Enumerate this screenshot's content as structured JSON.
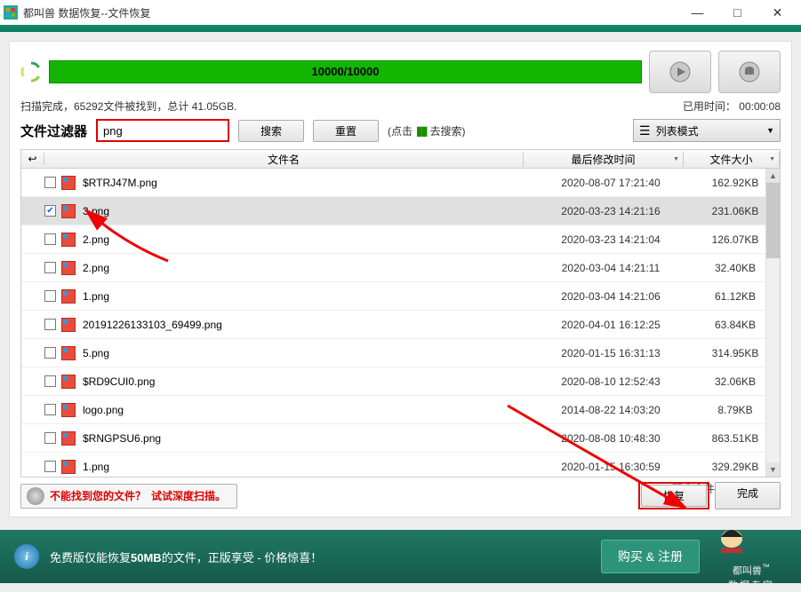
{
  "window": {
    "title": "都叫兽 数据恢复--文件恢复",
    "minimize": "—",
    "maximize": "□",
    "close": "✕"
  },
  "progress": {
    "text": "10000/10000"
  },
  "status": {
    "left": "扫描完成，65292文件被找到，总计 41.05GB.",
    "right_label": "已用时间：",
    "right_value": "00:00:08"
  },
  "filter": {
    "label": "文件过滤器",
    "value": "png",
    "search": "搜索",
    "reset": "重置",
    "hint_prefix": "(点击",
    "hint_suffix": "去搜索)",
    "view_mode": "列表模式"
  },
  "headers": {
    "back_icon": "↩",
    "name": "文件名",
    "date": "最后修改时间",
    "size": "文件大小"
  },
  "rows": [
    {
      "checked": false,
      "name": "$RTRJ47M.png",
      "date": "2020-08-07 17:21:40",
      "size": "162.92KB"
    },
    {
      "checked": true,
      "name": "3.png",
      "date": "2020-03-23 14:21:16",
      "size": "231.06KB",
      "selected": true
    },
    {
      "checked": false,
      "name": "2.png",
      "date": "2020-03-23 14:21:04",
      "size": "126.07KB"
    },
    {
      "checked": false,
      "name": "2.png",
      "date": "2020-03-04 14:21:11",
      "size": "32.40KB"
    },
    {
      "checked": false,
      "name": "1.png",
      "date": "2020-03-04 14:21:06",
      "size": "61.12KB"
    },
    {
      "checked": false,
      "name": "20191226133103_69499.png",
      "date": "2020-04-01 16:12:25",
      "size": "63.84KB"
    },
    {
      "checked": false,
      "name": "5.png",
      "date": "2020-01-15 16:31:13",
      "size": "314.95KB"
    },
    {
      "checked": false,
      "name": "$RD9CUI0.png",
      "date": "2020-08-10 12:52:43",
      "size": "32.06KB"
    },
    {
      "checked": false,
      "name": "logo.png",
      "date": "2014-08-22 14:03:20",
      "size": "8.79KB"
    },
    {
      "checked": false,
      "name": "$RNGPSU6.png",
      "date": "2020-08-08 10:48:30",
      "size": "863.51KB"
    },
    {
      "checked": false,
      "name": "1.png",
      "date": "2020-01-15 16:30:59",
      "size": "329.29KB"
    }
  ],
  "preview_hint": "双击文件即可预览。",
  "deep_scan": {
    "q": "不能找到您的文件？",
    "action": "试试深度扫描。"
  },
  "buttons": {
    "recover": "恢复",
    "done": "完成"
  },
  "footer": {
    "msg_prefix": "免费版仅能恢复",
    "msg_bold": "50MB",
    "msg_suffix": "的文件，正版享受 - 价格惊喜！",
    "buy": "购买 & 注册",
    "brand": "都叫兽",
    "tagline": "数据专家",
    "tm": "™"
  }
}
